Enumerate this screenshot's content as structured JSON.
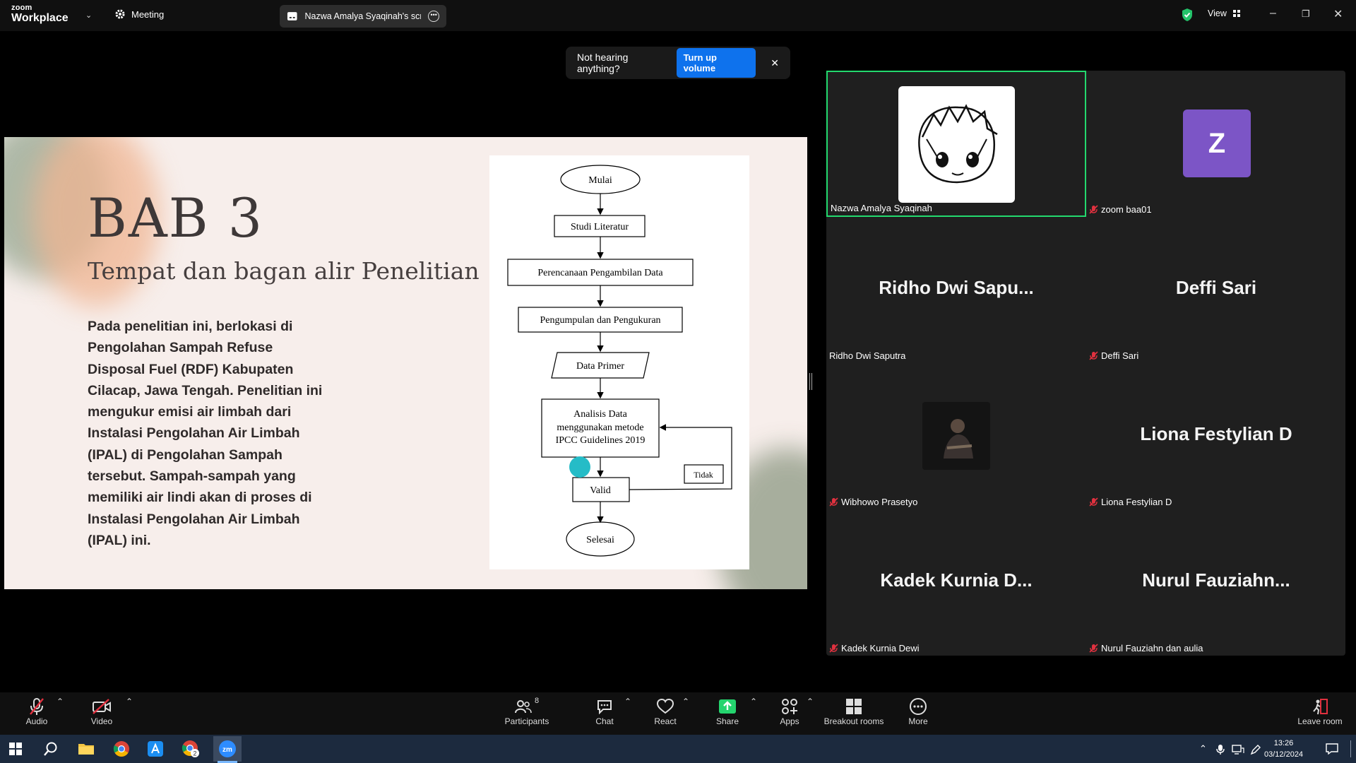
{
  "topbar": {
    "logo_small": "zoom",
    "logo_big": "Workplace",
    "meeting_label": "Meeting",
    "share_indicator": "Nazwa Amalya Syaqinah's screen",
    "view_label": "View"
  },
  "notification": {
    "message": "Not hearing anything?",
    "action": "Turn up volume"
  },
  "slide": {
    "title": "BAB 3",
    "subtitle": "Tempat dan bagan alir Penelitian",
    "body": "Pada penelitian ini, berlokasi di Pengolahan Sampah Refuse Disposal Fuel (RDF) Kabupaten Cilacap, Jawa Tengah. Penelitian ini mengukur emisi air limbah dari Instalasi Pengolahan Air Limbah (IPAL) di Pengolahan Sampah tersebut. Sampah-sampah yang memiliki air lindi akan di proses di Instalasi Pengolahan Air Limbah (IPAL) ini.",
    "flowchart": {
      "start": "Mulai",
      "step1": "Studi Literatur",
      "step2": "Perencanaan Pengambilan Data",
      "step3": "Pengumpulan dan Pengukuran",
      "step4": "Data Primer",
      "step5_line1": "Analisis Data",
      "step5_line2": "menggunakan metode",
      "step5_line3": "IPCC Guidelines 2019",
      "decision": "Valid",
      "no_label": "Tidak",
      "end": "Selesai"
    }
  },
  "participants": [
    {
      "name": "Nazwa Amalya Syaqinah",
      "muted": false,
      "display": "",
      "active": true
    },
    {
      "name": "zoom baa01",
      "muted": true,
      "display": "Z"
    },
    {
      "name": "Ridho Dwi Saputra",
      "muted": false,
      "display": "Ridho Dwi Sapu..."
    },
    {
      "name": "Deffi Sari",
      "muted": true,
      "display": "Deffi Sari"
    },
    {
      "name": "Wibhowo Prasetyo",
      "muted": true,
      "display": ""
    },
    {
      "name": "Liona Festylian D",
      "muted": true,
      "display": "Liona Festylian D"
    },
    {
      "name": "Kadek Kurnia Dewi",
      "muted": true,
      "display": "Kadek Kurnia D..."
    },
    {
      "name": "Nurul Fauziahn dan aulia",
      "muted": true,
      "display": "Nurul  Fauziahn..."
    }
  ],
  "toolbar": {
    "audio": "Audio",
    "video": "Video",
    "participants": "Participants",
    "participants_count": "8",
    "chat": "Chat",
    "react": "React",
    "share": "Share",
    "apps": "Apps",
    "breakout": "Breakout rooms",
    "more": "More",
    "leave": "Leave room"
  },
  "taskbar": {
    "time": "13:26",
    "date": "03/12/2024",
    "chrome_badge": "2"
  },
  "colors": {
    "active_speaker": "#23d96e",
    "turn_up_button": "#0e72ed",
    "share_button": "#24d46e",
    "avatar_z": "#7c55c6",
    "cursor_dot": "#25bcc7"
  }
}
